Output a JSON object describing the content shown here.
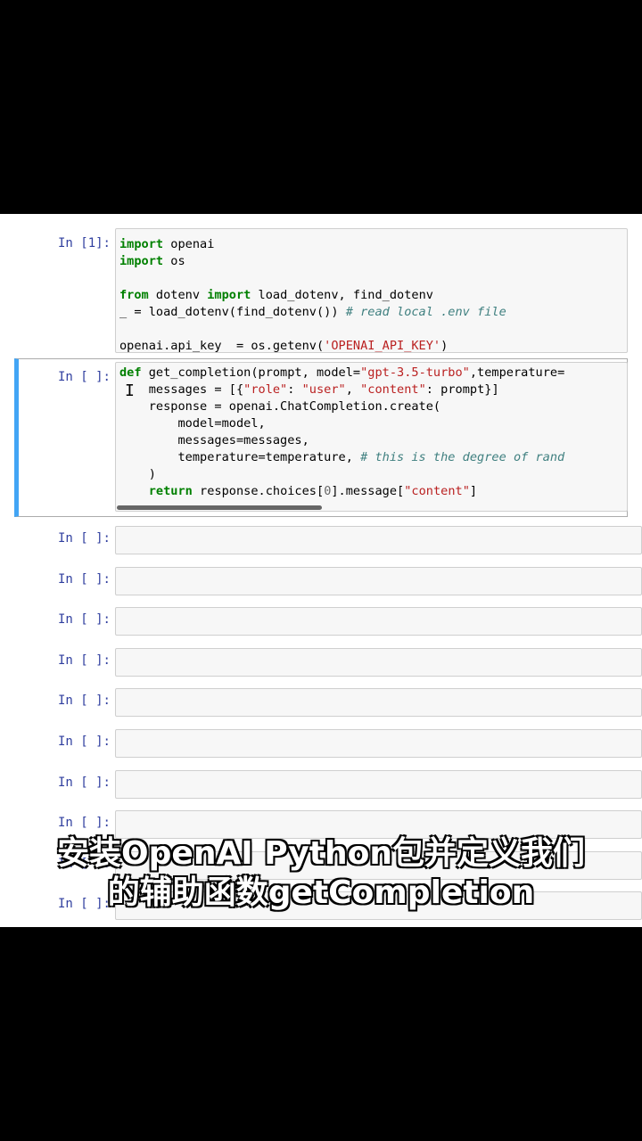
{
  "cells": [
    {
      "prompt": "In [1]:",
      "lines": [
        [
          {
            "t": "import",
            "c": "kw"
          },
          {
            "t": " openai"
          }
        ],
        [
          {
            "t": "import",
            "c": "kw"
          },
          {
            "t": " os"
          }
        ],
        [],
        [
          {
            "t": "from",
            "c": "kw"
          },
          {
            "t": " dotenv "
          },
          {
            "t": "import",
            "c": "kw"
          },
          {
            "t": " load_dotenv, find_dotenv"
          }
        ],
        [
          {
            "t": "_ = load_dotenv(find_dotenv()) "
          },
          {
            "t": "# read local .env file",
            "c": "cm"
          }
        ],
        [],
        [
          {
            "t": "openai.api_key  = os.getenv("
          },
          {
            "t": "'OPENAI_API_KEY'",
            "c": "str"
          },
          {
            "t": ")"
          }
        ]
      ]
    },
    {
      "prompt": "In [ ]:",
      "lines": [
        [
          {
            "t": "def",
            "c": "kw"
          },
          {
            "t": " get_completion(prompt, model="
          },
          {
            "t": "\"gpt-3.5-turbo\"",
            "c": "str"
          },
          {
            "t": ",temperature="
          }
        ],
        [
          {
            "t": "    messages = [{"
          },
          {
            "t": "\"role\"",
            "c": "str"
          },
          {
            "t": ": "
          },
          {
            "t": "\"user\"",
            "c": "str"
          },
          {
            "t": ", "
          },
          {
            "t": "\"content\"",
            "c": "str"
          },
          {
            "t": ": prompt}]"
          }
        ],
        [
          {
            "t": "    response = openai.ChatCompletion.create("
          }
        ],
        [
          {
            "t": "        model=model,"
          }
        ],
        [
          {
            "t": "        messages=messages,"
          }
        ],
        [
          {
            "t": "        temperature=temperature, "
          },
          {
            "t": "# this is the degree of rand",
            "c": "cm"
          }
        ],
        [
          {
            "t": "    )"
          }
        ],
        [
          {
            "t": "    "
          },
          {
            "t": "return",
            "c": "kw"
          },
          {
            "t": " response.choices["
          },
          {
            "t": "0",
            "c": "num"
          },
          {
            "t": "].message["
          },
          {
            "t": "\"content\"",
            "c": "str"
          },
          {
            "t": "]"
          }
        ]
      ]
    }
  ],
  "empty_prompt": "In [ ]:",
  "empty_cell_count": 10,
  "caption_line1": "安装OpenAI Python包并定义我们",
  "caption_line2": "的辅助函数getCompletion",
  "cursor_glyph": "I"
}
